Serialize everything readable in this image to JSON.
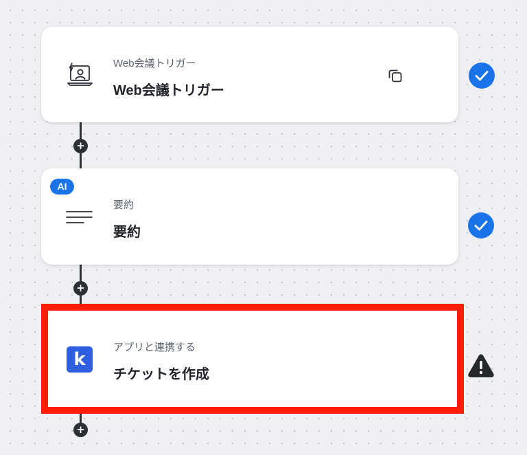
{
  "workflow": {
    "steps": [
      {
        "subtitle": "Web会議トリガー",
        "title": "Web会議トリガー",
        "icon": "web-meeting-trigger-icon",
        "status": "completed",
        "status_icon": "check-circle-icon"
      },
      {
        "badge": "AI",
        "subtitle": "要約",
        "title": "要約",
        "icon": "summary-lines-icon",
        "status": "completed",
        "status_icon": "check-circle-icon"
      },
      {
        "subtitle": "アプリと連携する",
        "title": "チケットを作成",
        "icon": "kintone-app-icon",
        "logo_letter": "k",
        "status": "warning",
        "status_icon": "warning-icon",
        "highlighted": true
      }
    ],
    "add_node_glyph": "+"
  },
  "colors": {
    "canvas": "#eef0f3",
    "connector": "#2b2f36",
    "check_blue": "#1a73e8",
    "highlight_border": "#ff1e0a",
    "kintone_blue": "#2f5fe0",
    "warning": "#25282d"
  }
}
